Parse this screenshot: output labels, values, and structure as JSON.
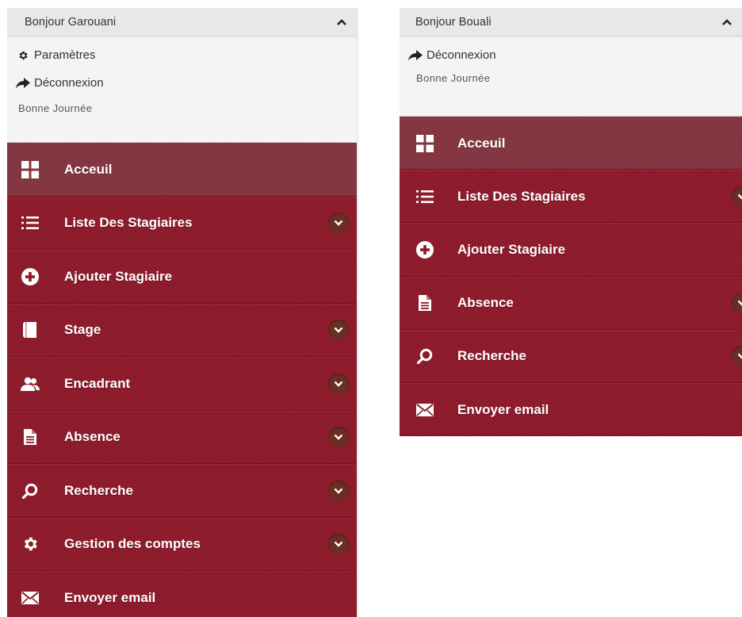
{
  "left_panel": {
    "greeting": "Bonjour Garouani",
    "links": [
      {
        "label": "Paramètres",
        "icon": "gear-icon"
      },
      {
        "label": "Déconnexion",
        "icon": "share-arrow-icon"
      }
    ],
    "note": "Bonne Journée",
    "menu": [
      {
        "label": "Acceuil",
        "icon": "dashboard-icon",
        "active": true,
        "submenu": false
      },
      {
        "label": "Liste Des Stagiaires",
        "icon": "list-icon",
        "submenu": true
      },
      {
        "label": "Ajouter Stagiaire",
        "icon": "plus-circle-icon",
        "submenu": false
      },
      {
        "label": "Stage",
        "icon": "book-icon",
        "submenu": true
      },
      {
        "label": "Encadrant",
        "icon": "users-icon",
        "submenu": true
      },
      {
        "label": "Absence",
        "icon": "document-icon",
        "submenu": true
      },
      {
        "label": "Recherche",
        "icon": "search-icon",
        "submenu": true
      },
      {
        "label": "Gestion des comptes",
        "icon": "gear-icon",
        "submenu": true
      },
      {
        "label": "Envoyer email",
        "icon": "envelope-icon",
        "submenu": false
      }
    ]
  },
  "right_panel": {
    "greeting": "Bonjour Bouali",
    "links": [
      {
        "label": "Déconnexion",
        "icon": "share-arrow-icon"
      }
    ],
    "note": "Bonne Journée",
    "menu": [
      {
        "label": "Acceuil",
        "icon": "dashboard-icon",
        "active": true,
        "submenu": false
      },
      {
        "label": "Liste Des Stagiaires",
        "icon": "list-icon",
        "submenu": true
      },
      {
        "label": "Ajouter Stagiaire",
        "icon": "plus-circle-icon",
        "submenu": false
      },
      {
        "label": "Absence",
        "icon": "document-icon",
        "submenu": true
      },
      {
        "label": "Recherche",
        "icon": "search-icon",
        "submenu": true
      },
      {
        "label": "Envoyer email",
        "icon": "envelope-icon",
        "submenu": false
      }
    ]
  },
  "colors": {
    "menu_bg": "#8c1a2b",
    "menu_active_bg": "#82343f",
    "chevron_bg": "#6a2e22",
    "user_box_bg": "#f4f4f4",
    "user_header_bg": "#e8e8e8"
  }
}
